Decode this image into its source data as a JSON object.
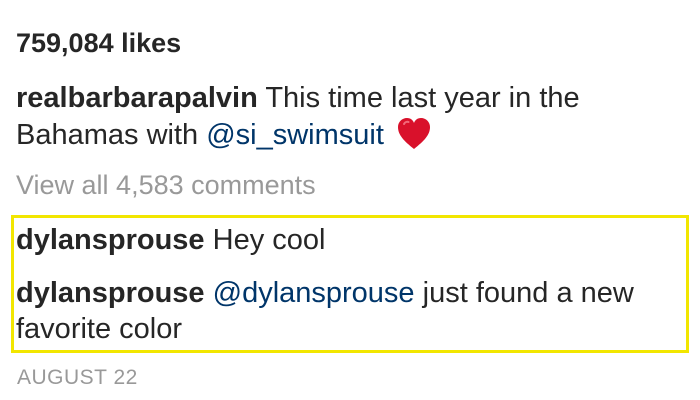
{
  "post": {
    "likes_text": "759,084 likes",
    "caption": {
      "username": "realbarbarapalvin",
      "text_before_mention": "This time last year in the Bahamas with",
      "mention": "@si_swimsuit",
      "emoji_icon": "red-heart-icon"
    },
    "view_all_comments": "View all 4,583 comments",
    "comments": [
      {
        "username": "dylansprouse",
        "text": "Hey cool"
      },
      {
        "username": "dylansprouse",
        "mention": "@dylansprouse",
        "text": "just found a new favorite color"
      }
    ],
    "timestamp": "AUGUST 22"
  },
  "colors": {
    "highlight": "#f2e600",
    "mention": "#003569",
    "muted": "#999999",
    "heart": "#d9112b"
  }
}
